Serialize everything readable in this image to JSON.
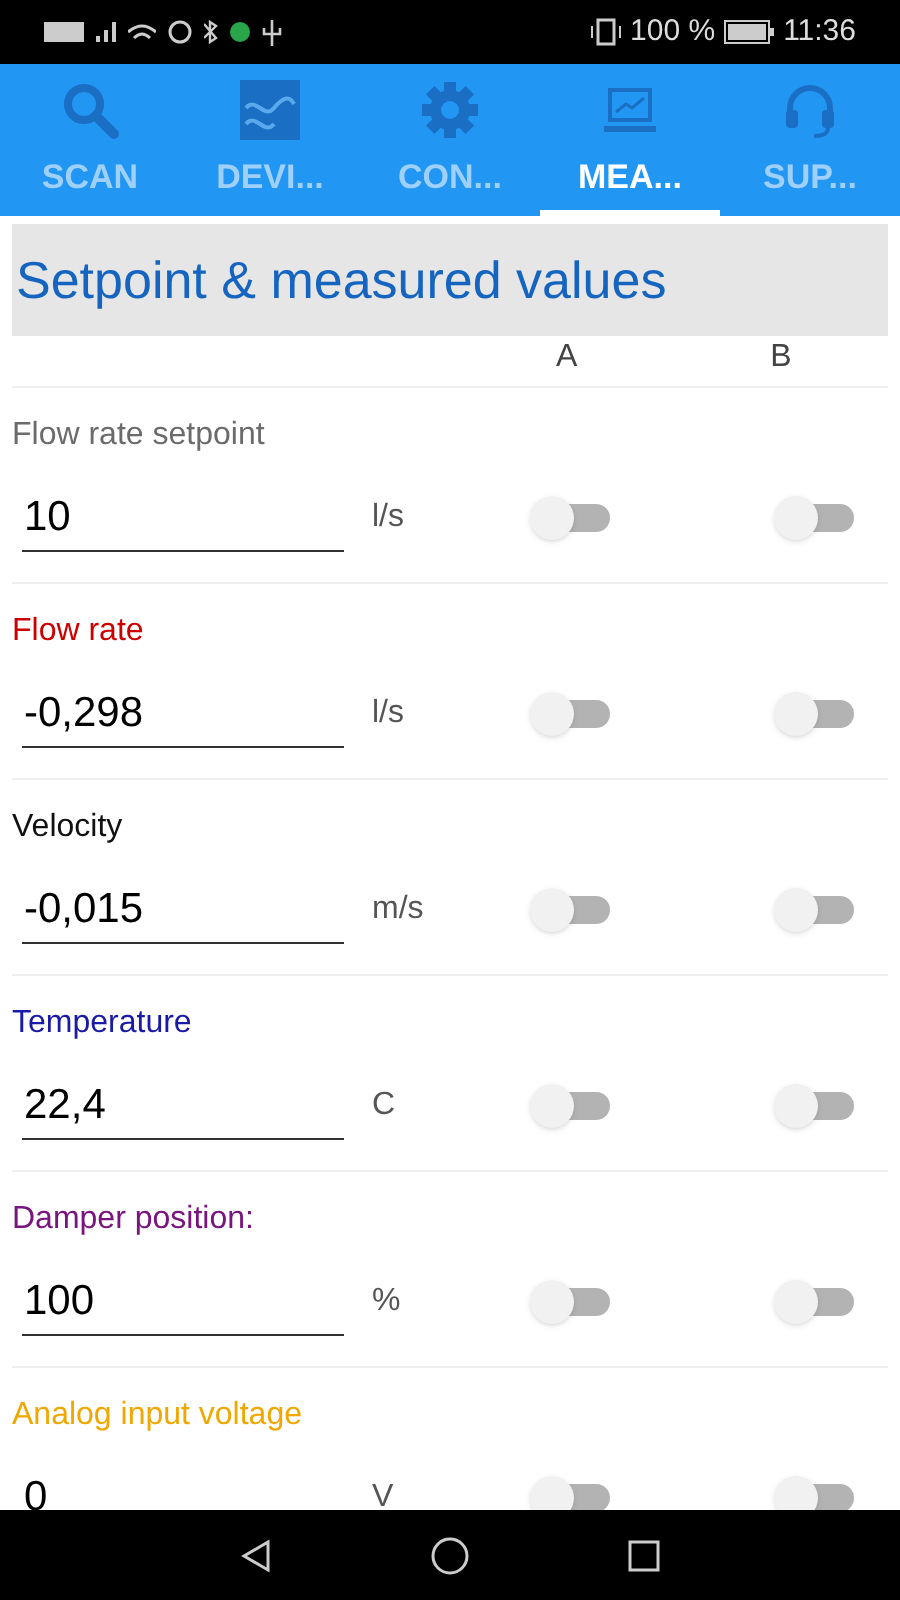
{
  "status_bar": {
    "battery": "100 %",
    "time": "11:36"
  },
  "tabs": [
    {
      "label": "SCAN",
      "selected": false
    },
    {
      "label": "DEVI...",
      "selected": false
    },
    {
      "label": "CON...",
      "selected": false
    },
    {
      "label": "MEA...",
      "selected": true
    },
    {
      "label": "SUP...",
      "selected": false
    }
  ],
  "section": {
    "title": "Setpoint & measured values",
    "columns": [
      "A",
      "B"
    ]
  },
  "rows": [
    {
      "label": "Flow rate setpoint",
      "color": "#6b6b6b",
      "value": "10",
      "unit": "l/s",
      "a_on": false,
      "b_on": false
    },
    {
      "label": "Flow rate",
      "color": "#cc0000",
      "value": "-0,298",
      "unit": "l/s",
      "a_on": false,
      "b_on": false
    },
    {
      "label": "Velocity",
      "color": "#111111",
      "value": "-0,015",
      "unit": "m/s",
      "a_on": false,
      "b_on": false
    },
    {
      "label": "Temperature",
      "color": "#1a1aa6",
      "value": "22,4",
      "unit": "C",
      "a_on": false,
      "b_on": false
    },
    {
      "label": "Damper position:",
      "color": "#7a1580",
      "value": "100",
      "unit": "%",
      "a_on": false,
      "b_on": false
    },
    {
      "label": "Analog input voltage",
      "color": "#f0a800",
      "value": "0",
      "unit": "V",
      "a_on": false,
      "b_on": false
    }
  ]
}
